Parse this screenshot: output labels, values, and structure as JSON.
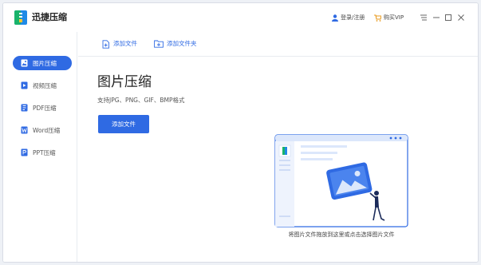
{
  "app": {
    "title": "迅捷压缩"
  },
  "header": {
    "login_label": "登录/注册",
    "vip_label": "购买VIP"
  },
  "toolbar": {
    "add_file": "添加文件",
    "add_folder": "添加文件夹"
  },
  "sidebar": {
    "items": [
      {
        "label": "图片压缩",
        "icon": "image-icon",
        "active": true
      },
      {
        "label": "视频压缩",
        "icon": "video-icon",
        "active": false
      },
      {
        "label": "PDF压缩",
        "icon": "pdf-icon",
        "active": false
      },
      {
        "label": "Word压缩",
        "icon": "word-icon",
        "active": false
      },
      {
        "label": "PPT压缩",
        "icon": "ppt-icon",
        "active": false
      }
    ]
  },
  "main": {
    "title": "图片压缩",
    "subtitle": "支持JPG、PNG、GIF、BMP格式",
    "add_button": "添加文件",
    "drop_hint": "将图片文件拖放到这里或点击选择图片文件"
  },
  "colors": {
    "accent": "#2f6ae3",
    "light_accent": "#dce7fb"
  }
}
